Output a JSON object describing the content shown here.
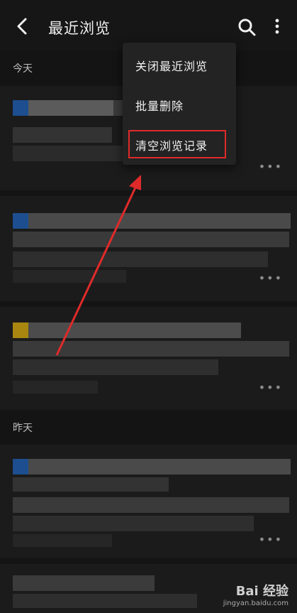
{
  "appbar": {
    "title": "最近浏览"
  },
  "sections": [
    {
      "label": "今天"
    },
    {
      "label": "昨天"
    }
  ],
  "cards": [
    {
      "more": "•••",
      "accent": "#1d4e8f"
    },
    {
      "more": "•••",
      "accent": "#1d4e8f"
    },
    {
      "more": "•••",
      "accent": "#a8860f"
    },
    {
      "more": "•••",
      "accent": "#1d4e8f"
    },
    {
      "more": "",
      "accent": ""
    }
  ],
  "menu": {
    "items": [
      {
        "label": "关闭最近浏览"
      },
      {
        "label": "批量删除"
      },
      {
        "label": "清空浏览记录"
      }
    ],
    "highlight_color": "#e02a2a"
  },
  "watermark": {
    "logo": "Bai 经验",
    "sub": "jingyan.baidu.com"
  },
  "icons": [
    "chevron-left-icon",
    "search-icon",
    "more-vertical-icon"
  ]
}
